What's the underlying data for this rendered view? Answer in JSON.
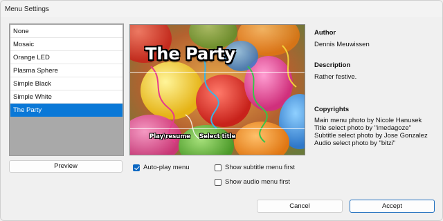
{
  "window": {
    "title": "Menu Settings"
  },
  "menu_list": {
    "items": [
      {
        "label": "None",
        "selected": false
      },
      {
        "label": "Mosaic",
        "selected": false
      },
      {
        "label": "Orange LED",
        "selected": false
      },
      {
        "label": "Plasma Sphere",
        "selected": false
      },
      {
        "label": "Simple Black",
        "selected": false
      },
      {
        "label": "Simple White",
        "selected": false
      },
      {
        "label": "The Party",
        "selected": true
      }
    ]
  },
  "preview_button": {
    "label": "Preview"
  },
  "preview": {
    "title": "The Party",
    "play_label": "Play\\resume",
    "select_label": "Select title"
  },
  "info": {
    "author_heading": "Author",
    "author": "Dennis Meuwissen",
    "description_heading": "Description",
    "description": "Rather festive.",
    "copyrights_heading": "Copyrights",
    "copyrights": [
      "Main menu photo by Nicole Hanusek",
      "Title select photo by \"imedagoze\"",
      "Subtitle select photo by Jose Gonzalez",
      "Audio select photo by \"bitzi\""
    ]
  },
  "options": {
    "autoplay": {
      "label": "Auto-play menu",
      "checked": true
    },
    "subtitle_first": {
      "label": "Show subtitle menu first",
      "checked": false
    },
    "audio_first": {
      "label": "Show audio menu first",
      "checked": false
    }
  },
  "buttons": {
    "cancel": "Cancel",
    "accept": "Accept"
  },
  "colors": {
    "selection": "#0a78d7",
    "accent_border": "#1f6fbf",
    "checkbox": "#0a67c2"
  }
}
